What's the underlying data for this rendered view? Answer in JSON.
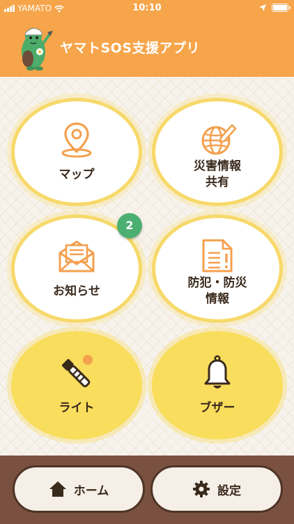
{
  "status_bar": {
    "carrier": "YAMATO",
    "time": "10:10"
  },
  "header": {
    "title": "ヤマトSOS支援アプリ"
  },
  "tiles": [
    {
      "label": "マップ",
      "icon": "map-pin-icon"
    },
    {
      "label": "災害情報\n共有",
      "icon": "globe-pencil-icon"
    },
    {
      "label": "お知らせ",
      "icon": "envelope-icon",
      "badge": "2"
    },
    {
      "label": "防犯・防災\n情報",
      "icon": "document-alert-icon"
    },
    {
      "label": "ライト",
      "icon": "flashlight-icon"
    },
    {
      "label": "ブザー",
      "icon": "bell-icon"
    }
  ],
  "bottom_nav": {
    "home_label": "ホーム",
    "settings_label": "設定"
  },
  "colors": {
    "header": "#f7a54a",
    "accent_icon": "#f4a04e",
    "tile_border": "#f7d96a",
    "tile_fill": "#f9dd5c",
    "badge": "#4caf72",
    "bottom_bar": "#7a5140"
  }
}
